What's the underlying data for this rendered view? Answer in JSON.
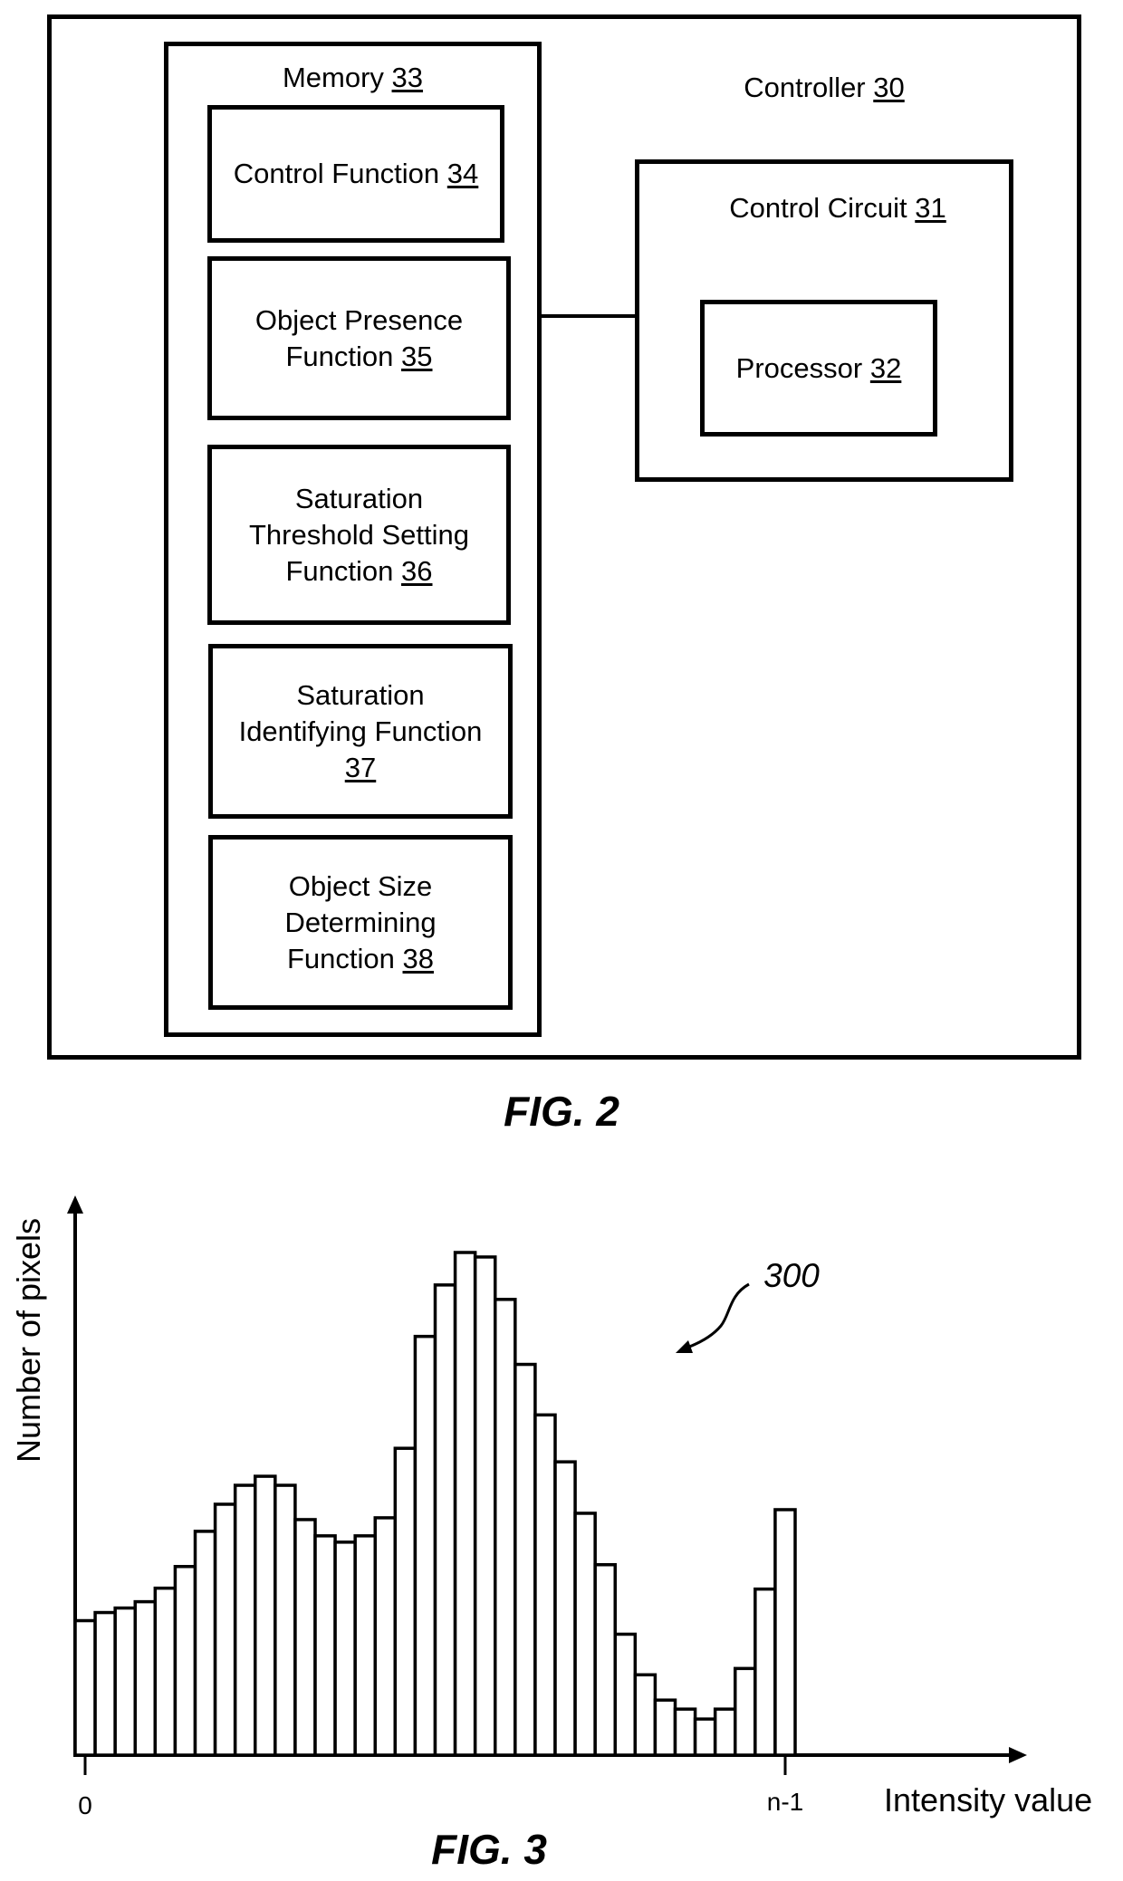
{
  "fig2": {
    "caption": "FIG. 2",
    "controller": {
      "label": "Controller",
      "ref": "30"
    },
    "memory": {
      "label": "Memory",
      "ref": "33"
    },
    "functions": [
      {
        "lines": [
          "Control Function"
        ],
        "ref": "34",
        "ref_on_last_line": true
      },
      {
        "lines": [
          "Object Presence",
          "Function"
        ],
        "ref": "35",
        "ref_on_last_line": true
      },
      {
        "lines": [
          "Saturation",
          "Threshold Setting",
          "Function"
        ],
        "ref": "36",
        "ref_on_last_line": true
      },
      {
        "lines": [
          "Saturation",
          "Identifying Function"
        ],
        "ref": "37",
        "ref_on_last_line": false
      },
      {
        "lines": [
          "Object Size",
          "Determining",
          "Function"
        ],
        "ref": "38",
        "ref_on_last_line": true
      }
    ],
    "control_circuit": {
      "label": "Control Circuit",
      "ref": "31"
    },
    "processor": {
      "label": "Processor",
      "ref": "32"
    }
  },
  "fig3": {
    "caption": "FIG. 3",
    "reference_numeral": "300",
    "chart_data": {
      "type": "bar",
      "title": "",
      "xlabel": "Intensity value",
      "ylabel": "Number of pixels",
      "x_tick_labels": [
        "0",
        "n-1"
      ],
      "bins": 36,
      "values_relative": [
        149,
        158,
        163,
        170,
        185,
        209,
        248,
        278,
        299,
        309,
        299,
        261,
        243,
        236,
        243,
        263,
        340,
        464,
        521,
        557,
        552,
        505,
        433,
        377,
        325,
        268,
        211,
        134,
        89,
        61,
        51,
        40,
        51,
        96,
        184,
        272
      ],
      "ylim": [
        0,
        560
      ],
      "grid": false,
      "legend": "none"
    }
  }
}
